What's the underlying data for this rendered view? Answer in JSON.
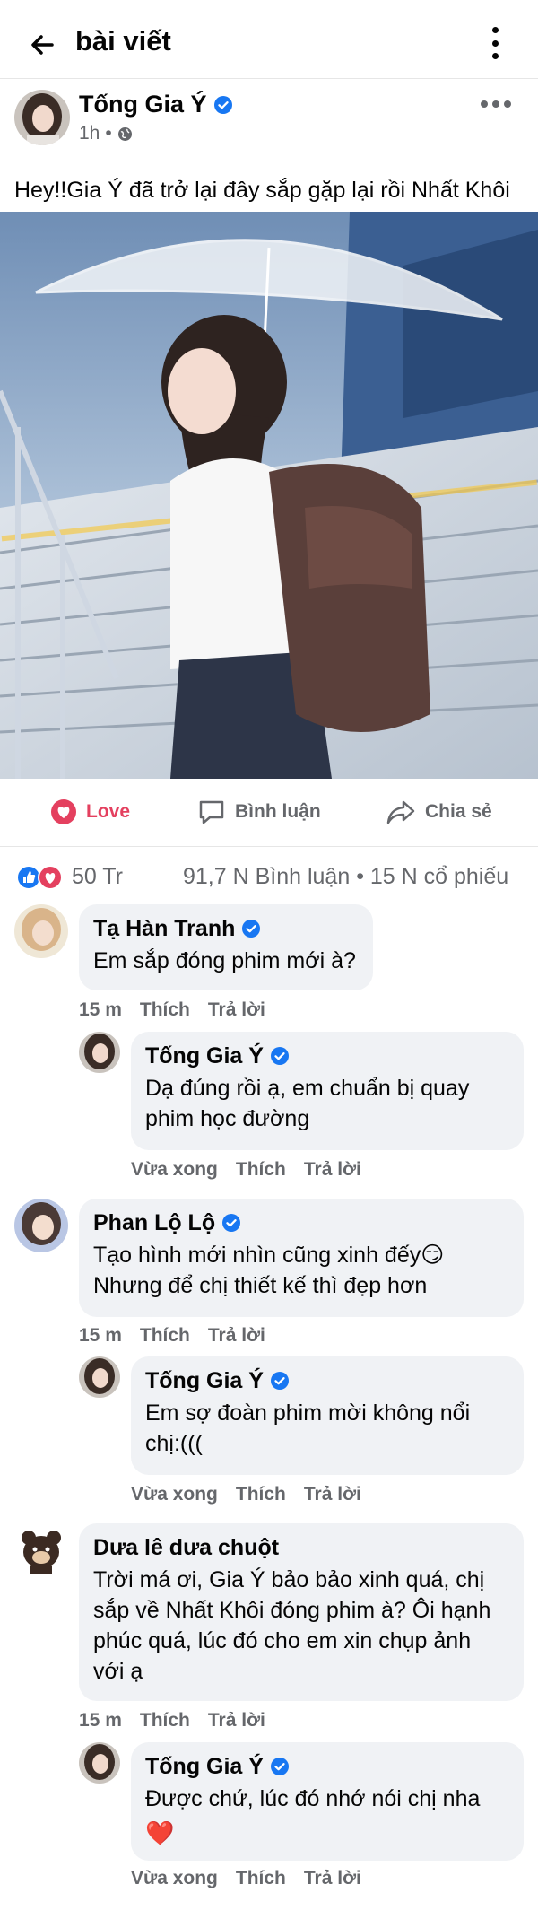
{
  "header": {
    "title": "bài viết",
    "back_icon": "arrow-left-icon",
    "menu_icon": "more-vertical-icon"
  },
  "post": {
    "author": "Tống Gia Ý",
    "time": "1h",
    "separator": "•",
    "privacy_icon": "globe-icon",
    "text": "Hey!!Gia Ý đã trở lại đây sắp gặp lại rồi Nhất Khôi"
  },
  "actions": {
    "love": "Love",
    "comment": "Bình luận",
    "share": "Chia sẻ"
  },
  "stats": {
    "reactions": "50 Tr",
    "comments_shares": "91,7 N  Bình luận • 15 N  cổ phiếu"
  },
  "comments": [
    {
      "name": "Tạ Hàn Tranh",
      "verified": true,
      "text": "Em sắp đóng phim mới à?",
      "time": "15 m",
      "like": "Thích",
      "reply": "Trả lời",
      "reply_to": {
        "name": "Tống Gia Ý",
        "verified": true,
        "text": "Dạ đúng rồi ạ, em chuẩn bị quay\nphim học đường",
        "time": "Vừa xong",
        "like": "Thích",
        "reply": "Trả lời"
      }
    },
    {
      "name": "Phan Lộ Lộ",
      "verified": true,
      "text": "Tạo hình mới nhìn cũng xinh đếy😏\nNhưng để chị thiết kế thì đẹp hơn",
      "time": "15 m",
      "like": "Thích",
      "reply": "Trả lời",
      "reply_to": {
        "name": "Tống Gia Ý",
        "verified": true,
        "text": "Em sợ đoàn phim mời không nổi\nchị:(((",
        "time": "Vừa xong",
        "like": "Thích",
        "reply": "Trả lời"
      }
    },
    {
      "name": "Dưa lê dưa chuột",
      "verified": false,
      "text": "Trời má ơi, Gia Ý bảo bảo xinh quá, chị\nsắp về Nhất Khôi đóng phim à? Ôi hạnh\nphúc quá, lúc đó cho em xin chụp ảnh\nvới ạ",
      "time": "15 m",
      "like": "Thích",
      "reply": "Trả lời",
      "reply_to": {
        "name": "Tống Gia Ý",
        "verified": true,
        "text": "Được chứ, lúc đó nhớ nói chị nha",
        "emoji": "❤️",
        "time": "Vừa xong",
        "like": "Thích",
        "reply": "Trả lời"
      }
    }
  ],
  "colors": {
    "love": "#e4405f",
    "verified": "#1877f2",
    "bubble": "#f0f2f5",
    "muted": "#65676b"
  }
}
